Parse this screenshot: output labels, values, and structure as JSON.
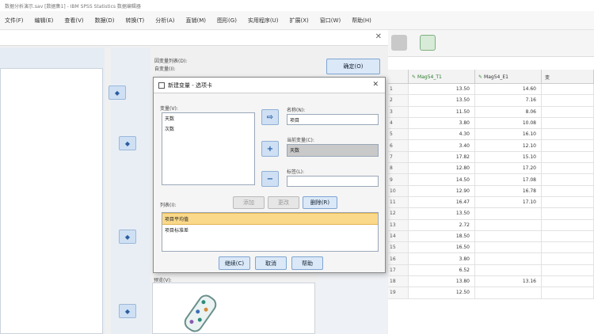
{
  "window": {
    "title": "数据分析演示.sav [数据集1] - IBM SPSS Statistics 数据编辑器"
  },
  "menu": [
    "文件(F)",
    "编辑(E)",
    "查看(V)",
    "数据(D)",
    "转换(T)",
    "分析(A)",
    "直销(M)",
    "图形(G)",
    "实用程序(U)",
    "扩展(X)",
    "窗口(W)",
    "帮助(H)"
  ],
  "outer_dialog": {
    "top_labels": [
      "因变量列表(D):",
      "自变量(I):"
    ],
    "ok_label": "确定(O)",
    "preview_label": "预览(V):",
    "side_buttons": [
      "◆",
      "◆",
      "◆",
      "◆"
    ]
  },
  "sub_dialog": {
    "title": "新建变量 - 选项卡",
    "vars_label": "变量(V):",
    "vars": [
      "天数",
      "次数"
    ],
    "name_label": "名称(N):",
    "name_value": "项目",
    "current_label": "当前变量(C):",
    "current_value": "天数",
    "label_label": "标签(L):",
    "label_value": "",
    "list_label": "列表(I):",
    "tab_buttons": [
      "添加",
      "更改",
      "删除(R)"
    ],
    "list_items": [
      "项目平均值",
      "项目标准差"
    ],
    "selected_index": 0,
    "buttons": [
      "继续(C)",
      "取消",
      "帮助"
    ]
  },
  "grid": {
    "headers": [
      "",
      "Mag54_T1",
      "Mag54_E1",
      "变"
    ],
    "rows": [
      [
        "1",
        "13.50",
        "14.60",
        ""
      ],
      [
        "2",
        "13.50",
        "7.16",
        ""
      ],
      [
        "3",
        "11.50",
        "8.06",
        ""
      ],
      [
        "4",
        "3.80",
        "10.08",
        ""
      ],
      [
        "5",
        "4.30",
        "16.10",
        ""
      ],
      [
        "6",
        "3.40",
        "12.10",
        ""
      ],
      [
        "7",
        "17.82",
        "15.10",
        ""
      ],
      [
        "8",
        "12.80",
        "17.20",
        ""
      ],
      [
        "9",
        "14.50",
        "17.08",
        ""
      ],
      [
        "10",
        "12.90",
        "16.78",
        ""
      ],
      [
        "11",
        "16.47",
        "17.10",
        ""
      ],
      [
        "12",
        "13.50",
        "",
        ""
      ],
      [
        "13",
        "2.72",
        "",
        ""
      ],
      [
        "14",
        "18.50",
        "",
        ""
      ],
      [
        "15",
        "16.50",
        "",
        ""
      ],
      [
        "16",
        "3.80",
        "",
        ""
      ],
      [
        "17",
        "6.52",
        "",
        ""
      ],
      [
        "18",
        "13.80",
        "13.16",
        ""
      ],
      [
        "19",
        "12.50",
        "",
        ""
      ]
    ]
  },
  "colors": {
    "accent": "#2a5d9f",
    "selected_row": "#fbd98a",
    "button_fill": "#dbe8f7"
  }
}
